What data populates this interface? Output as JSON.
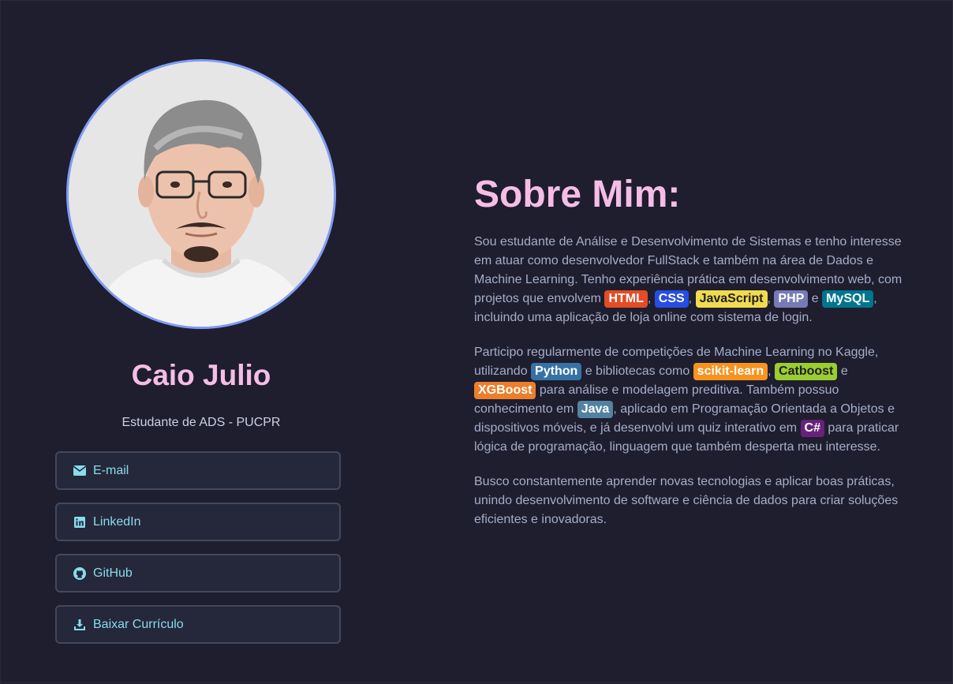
{
  "profile": {
    "name": "Caio Julio",
    "subtitle": "Estudante de ADS - PUCPR"
  },
  "links": [
    {
      "label": "E-mail",
      "icon": "envelope-icon"
    },
    {
      "label": "LinkedIn",
      "icon": "linkedin-icon"
    },
    {
      "label": "GitHub",
      "icon": "github-icon"
    },
    {
      "label": "Baixar Currículo",
      "icon": "download-icon"
    }
  ],
  "about": {
    "title": "Sobre Mim:",
    "p1": {
      "t1": "Sou estudante de Análise e Desenvolvimento de Sistemas e tenho interesse em atuar como desenvolvedor FullStack e também na área de Dados e Machine Learning. Tenho experiência prática em desenvolvimento web, com projetos que envolvem ",
      "tag_html": "HTML",
      "s1": ", ",
      "tag_css": "CSS",
      "s2": ", ",
      "tag_js": "JavaScript",
      "s3": ", ",
      "tag_php": "PHP",
      "s4": " e ",
      "tag_mysql": "MySQL",
      "t2": ", incluindo uma aplicação de loja online com sistema de login."
    },
    "p2": {
      "t1": "Participo regularmente de competições de Machine Learning no Kaggle, utilizando ",
      "tag_python": "Python",
      "s1": " e bibliotecas como ",
      "tag_sklearn": "scikit-learn",
      "s2": ", ",
      "tag_catboost": "Catboost",
      "s3": " e ",
      "tag_xgboost": "XGBoost",
      "t2": " para análise e modelagem preditiva. Também possuo conhecimento em ",
      "tag_java": "Java",
      "t3": ", aplicado em Programação Orientada a Objetos e dispositivos móveis, e já desenvolvi um quiz interativo em ",
      "tag_csharp": "C#",
      "t4": " para praticar lógica de programação, linguagem que também desperta meu interesse."
    },
    "p3": "Busco constantemente aprender novas tecnologias e aplicar boas práticas, unindo desenvolvimento de software e ciência de dados para criar soluções eficientes e inovadoras."
  },
  "colors": {
    "background": "#1e1e2e",
    "accent_pink": "#f5bde6",
    "accent_cyan": "#89dceb",
    "avatar_border": "#7f9cf5"
  }
}
